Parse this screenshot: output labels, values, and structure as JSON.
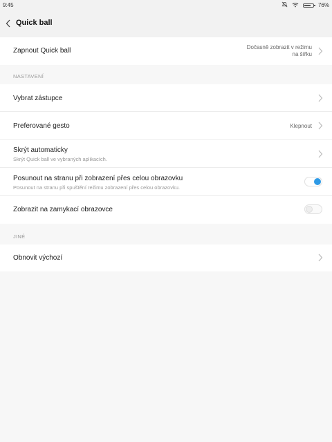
{
  "status_bar": {
    "time": "9:45",
    "battery": "76%",
    "battery_level": 0.76,
    "icons": [
      "bell-off-icon",
      "wifi-icon",
      "battery-icon"
    ]
  },
  "header": {
    "title": "Quick ball",
    "back_icon": "chevron-left-icon"
  },
  "rows": {
    "quick_ball": {
      "label": "Zapnout Quick ball",
      "value_line1": "Dočasně zobrazit v režimu",
      "value_line2": "na šířku"
    },
    "settings_header": "NASTAVENÍ",
    "shortcuts": {
      "label": "Vybrat zástupce"
    },
    "gesture": {
      "label": "Preferované gesto",
      "value": "Klepnout"
    },
    "autohide": {
      "label": "Skrýt automaticky",
      "sub": "Skrýt Quick ball ve vybraných aplikacích."
    },
    "fullscreen": {
      "label": "Posunout na stranu při zobrazení přes celou obrazovku",
      "sub": "Posunout na stranu při spuštění režimu zobrazení přes celou obrazovku.",
      "toggle_on": true
    },
    "lockscreen": {
      "label": "Zobrazit na zamykací obrazovce",
      "toggle_on": false
    },
    "other_header": "JINÉ",
    "reset": {
      "label": "Obnovit výchozí"
    }
  },
  "colors": {
    "accent": "#2e9ae6",
    "background": "#f7f7f7",
    "card": "#ffffff"
  }
}
